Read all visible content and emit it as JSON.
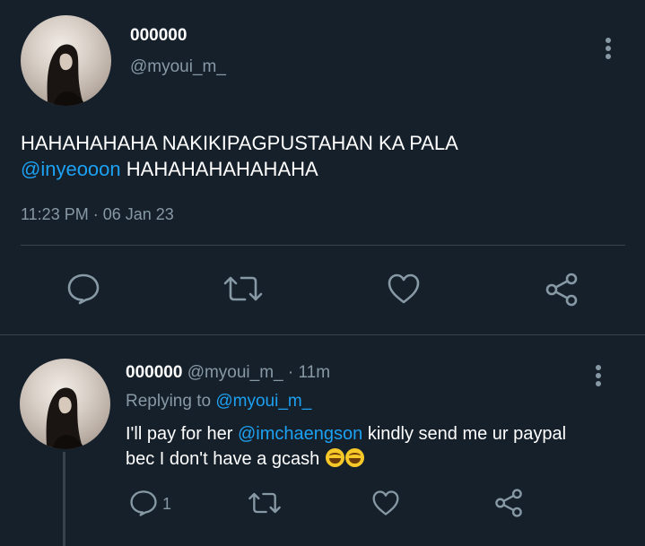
{
  "main_tweet": {
    "display_name": "000000",
    "handle": "@myoui_m_",
    "text_part1": "HAHAHAHAHA NAKIKIPAGPUSTAHAN KA PALA",
    "mention": "@inyeooon",
    "text_part2": " HAHAHAHAHAHAHA",
    "timestamp": "11:23 PM · 06 Jan 23"
  },
  "reply_tweet": {
    "display_name": "000000",
    "handle": "@myoui_m_",
    "separator": " · ",
    "age": "11m",
    "replying_prefix": "Replying to ",
    "replying_handle": "@myoui_m_",
    "text_part1": "I'll pay for her ",
    "mention": "@imchaengson",
    "text_part2": " kindly send me ur paypal bec I don't have a gcash",
    "reply_count": "1"
  },
  "colors": {
    "background": "#15202b",
    "accent": "#1da1f2",
    "muted": "#8899a6",
    "divider": "#38444d"
  },
  "icons": {
    "reply": "reply-icon",
    "retweet": "retweet-icon",
    "like": "heart-icon",
    "share": "share-icon",
    "more": "more-vertical-icon",
    "emoji": "laughing-tears-emoji"
  }
}
